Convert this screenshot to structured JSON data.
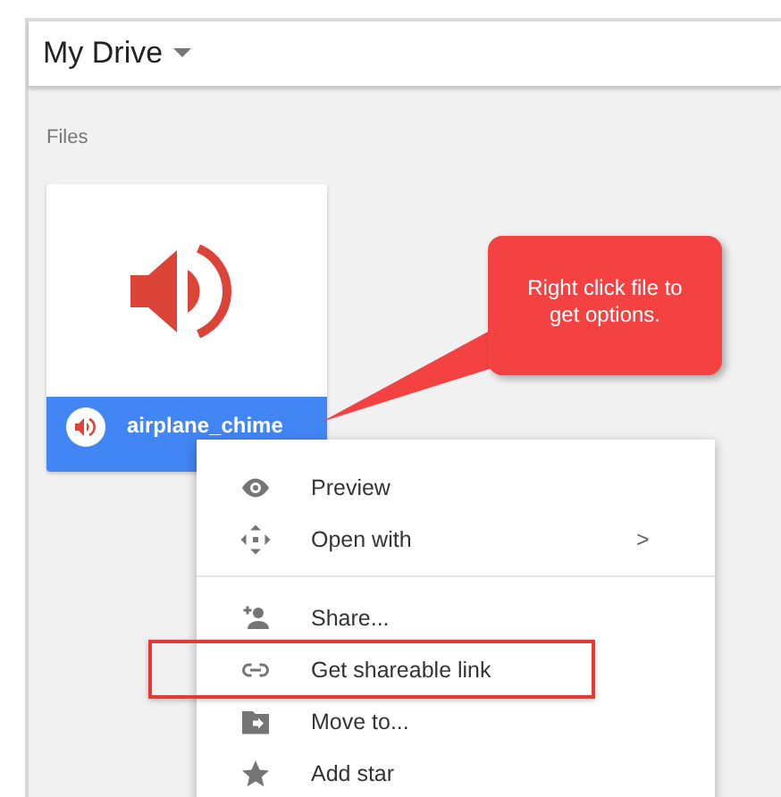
{
  "header": {
    "title": "My Drive"
  },
  "section_label": "Files",
  "file": {
    "name": "airplane_chime"
  },
  "callout": {
    "text": "Right click file to get options."
  },
  "menu": {
    "groups": [
      [
        {
          "label": "Preview",
          "kind": "eye",
          "highlighted": false
        },
        {
          "label": "Open with",
          "kind": "move",
          "highlighted": false,
          "arrow": ">"
        }
      ],
      [
        {
          "label": "Share...",
          "kind": "person-add",
          "highlighted": false
        },
        {
          "label": "Get shareable link",
          "kind": "link",
          "highlighted": true
        },
        {
          "label": "Move to...",
          "kind": "folder",
          "highlighted": false
        },
        {
          "label": "Add star",
          "kind": "star",
          "highlighted": false
        }
      ]
    ]
  }
}
